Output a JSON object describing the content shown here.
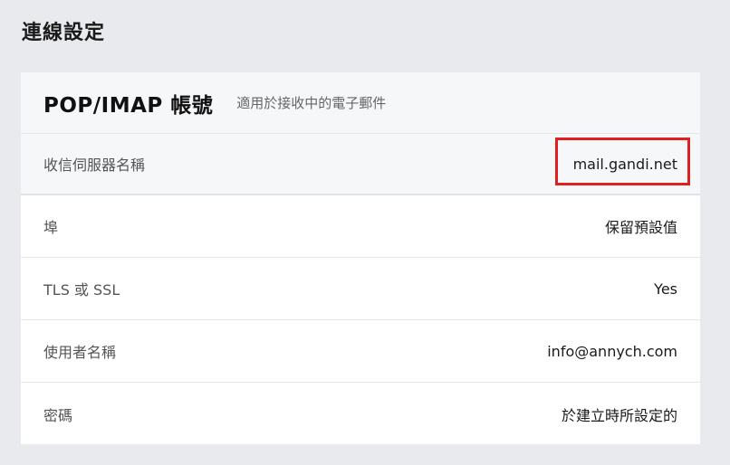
{
  "page": {
    "title": "連線設定"
  },
  "card": {
    "title": "POP/IMAP 帳號",
    "subtitle": "適用於接收中的電子郵件",
    "rows": [
      {
        "label": "收信伺服器名稱",
        "value": "mail.gandi.net"
      },
      {
        "label": "埠",
        "value": "保留預設值"
      },
      {
        "label": "TLS 或 SSL",
        "value": "Yes"
      },
      {
        "label": "使用者名稱",
        "value": "info@annych.com"
      },
      {
        "label": "密碼",
        "value": "於建立時所設定的"
      }
    ]
  },
  "colors": {
    "highlight": "#e02020",
    "background": "#e8eaed",
    "card_header": "#f6f7f9"
  }
}
